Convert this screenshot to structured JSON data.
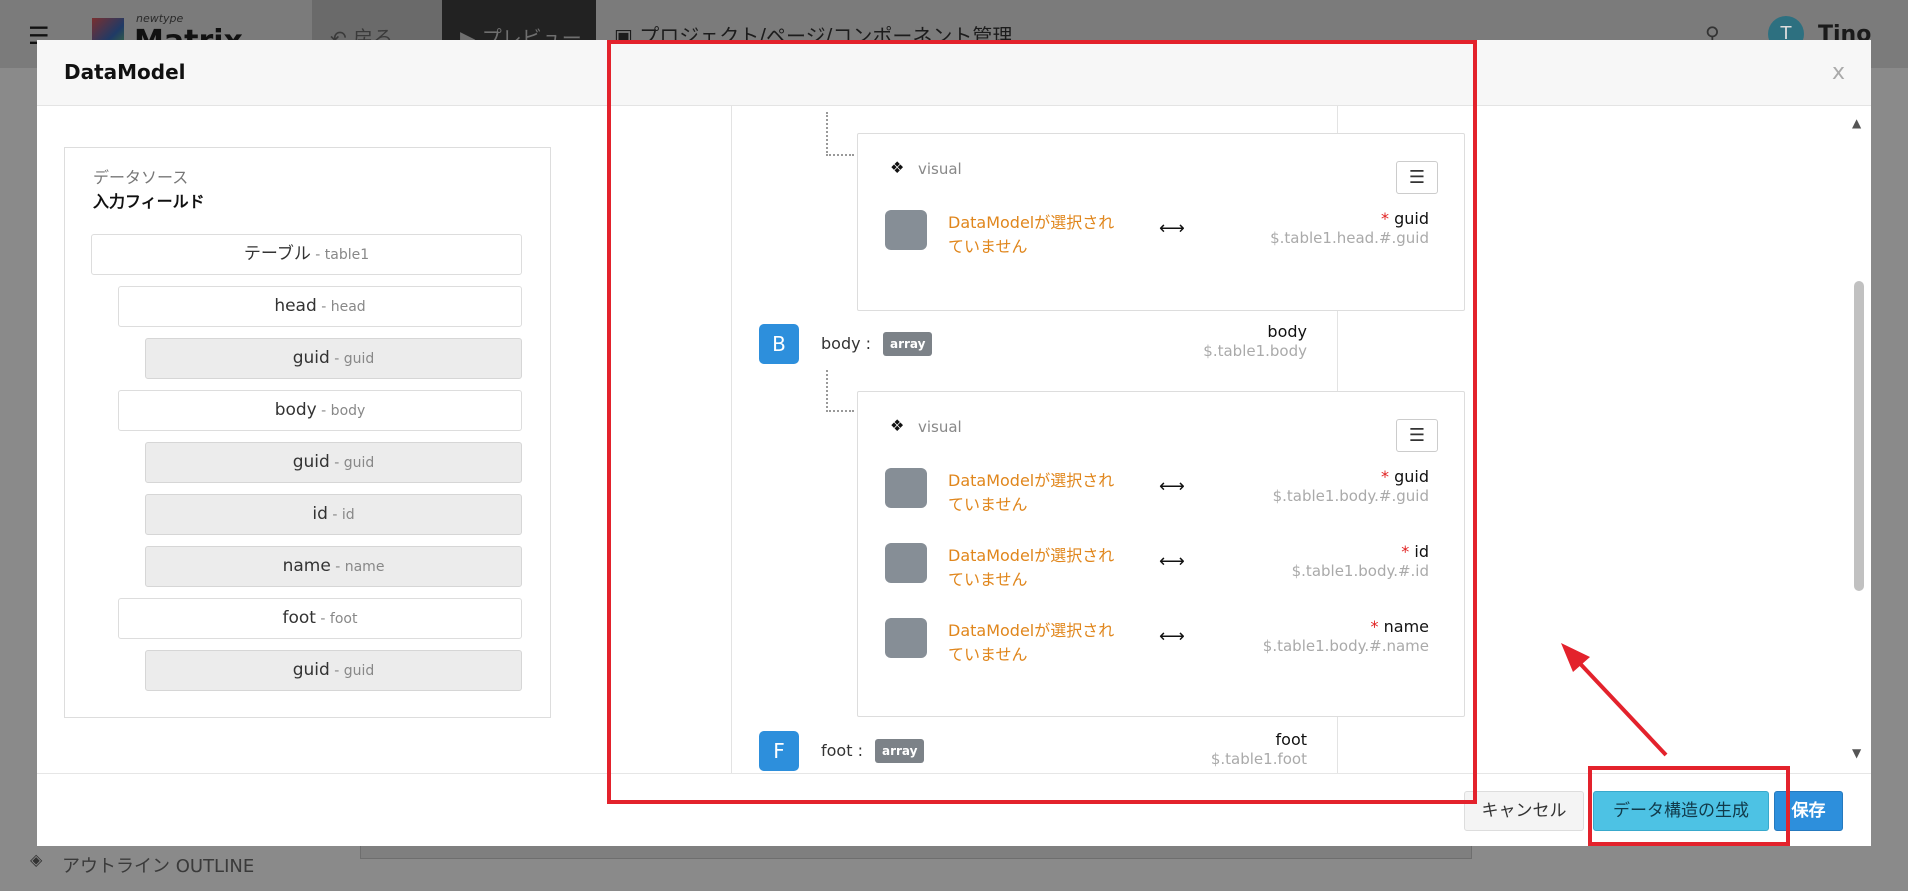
{
  "app": {
    "logo_sub": "newtype",
    "logo_main": "Matrix",
    "back_label": "戻る",
    "preview_label": "プレビュー",
    "manage_label": "プロジェクト/ページ/コンポーネント管理",
    "user_initial": "T",
    "user_name": "Tino",
    "outline_label": "アウトライン OUTLINE"
  },
  "modal": {
    "title": "DataModel",
    "close": "x"
  },
  "datasource": {
    "title": "データソース",
    "subtitle": "入力フィールド",
    "fields": [
      {
        "label": "テーブル",
        "key": " - table1"
      },
      {
        "label": "head",
        "key": " - head"
      },
      {
        "label": "guid",
        "key": " - guid"
      },
      {
        "label": "body",
        "key": " - body"
      },
      {
        "label": "guid",
        "key": " - guid"
      },
      {
        "label": "id",
        "key": " - id"
      },
      {
        "label": "name",
        "key": " - name"
      },
      {
        "label": "foot",
        "key": " - foot"
      },
      {
        "label": "guid",
        "key": " - guid"
      }
    ]
  },
  "mapping": {
    "visual_label": "visual",
    "warn": "DataModelが選択されていません",
    "head_rows": [
      {
        "name": "guid",
        "path": "$.table1.head.#.guid"
      }
    ],
    "body_node": {
      "letter": "B",
      "label": "body :",
      "type": "array",
      "name": "body",
      "path": "$.table1.body"
    },
    "body_rows": [
      {
        "name": "guid",
        "path": "$.table1.body.#.guid"
      },
      {
        "name": "id",
        "path": "$.table1.body.#.id"
      },
      {
        "name": "name",
        "path": "$.table1.body.#.name"
      }
    ],
    "foot_node": {
      "letter": "F",
      "label": "foot :",
      "type": "array",
      "name": "foot",
      "path": "$.table1.foot"
    }
  },
  "footer": {
    "cancel": "キャンセル",
    "generate": "データ構造の生成",
    "save": "保存"
  },
  "colors": {
    "accent": "#2d8fdc",
    "generate_button": "#4dc2e4",
    "warning_text": "#e0861c",
    "annotation": "#e3222c"
  }
}
